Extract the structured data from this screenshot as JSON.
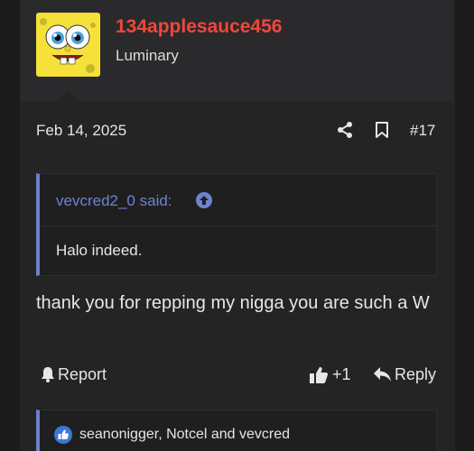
{
  "user": {
    "name": "134applesauce456",
    "title": "Luminary",
    "name_color": "#f0473a"
  },
  "post": {
    "date": "Feb 14, 2025",
    "number": "#17",
    "body": "thank you for repping my nigga you are such a W"
  },
  "quote": {
    "author": "vevcred2_0 said:",
    "text": "Halo indeed."
  },
  "actions": {
    "report_label": "Report",
    "like_count": "+1",
    "reply_label": "Reply"
  },
  "reactions": {
    "text": "seanonigger, Notcel and vevcred"
  },
  "icons": [
    "share-icon",
    "bookmark-icon",
    "arrow-up-circle-icon",
    "flag-icon",
    "thumbs-up-icon",
    "reply-arrow-icon",
    "like-badge-icon"
  ],
  "colors": {
    "accent": "#6a7fc9",
    "background": "#242425",
    "username": "#f0473a"
  }
}
